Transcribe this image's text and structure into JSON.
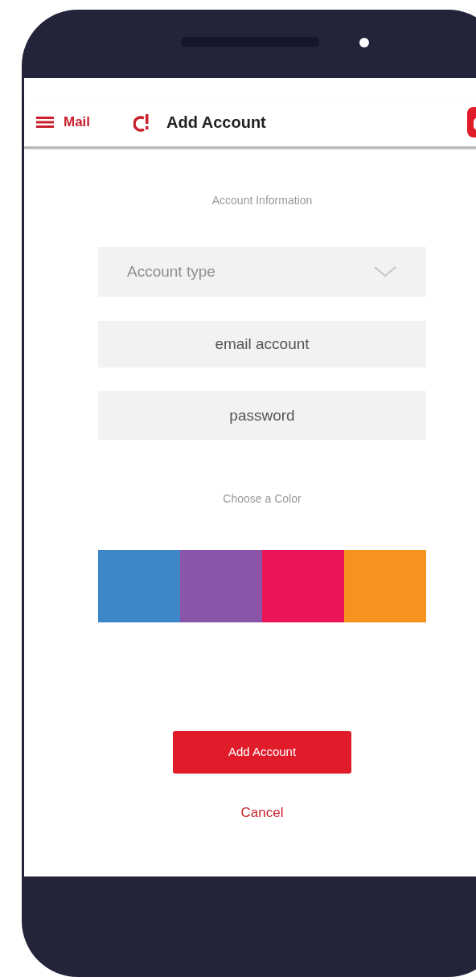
{
  "nav_bar": {
    "menu_label": "Mail",
    "title": "Add Account"
  },
  "form": {
    "section_title": "Account Information",
    "account_type": {
      "placeholder": "Account type"
    },
    "email": {
      "placeholder": "email account"
    },
    "password": {
      "placeholder": "password"
    },
    "color_title": "Choose a Color",
    "colors": [
      {
        "color": "#3d87c8"
      },
      {
        "color": "#8a55a8"
      },
      {
        "color": "#ea1458"
      },
      {
        "color": "#f6931e"
      }
    ]
  },
  "buttons": {
    "primary": "Add Account",
    "secondary": "Cancel"
  }
}
